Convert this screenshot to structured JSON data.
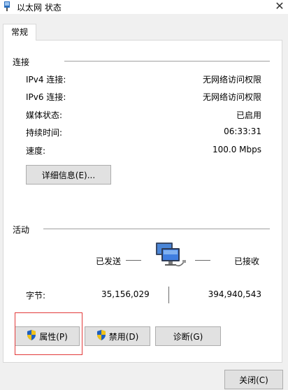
{
  "window": {
    "title": "以太网 状态",
    "close_glyph": "✕"
  },
  "tabs": [
    {
      "label": "常规"
    }
  ],
  "connection": {
    "heading": "连接",
    "rows": [
      {
        "label": "IPv4 连接:",
        "value": "无网络访问权限"
      },
      {
        "label": "IPv6 连接:",
        "value": "无网络访问权限"
      },
      {
        "label": "媒体状态:",
        "value": "已启用"
      },
      {
        "label": "持续时间:",
        "value": "06:33:31"
      },
      {
        "label": "速度:",
        "value": "100.0 Mbps"
      }
    ],
    "details_button": "详细信息(E)..."
  },
  "activity": {
    "heading": "活动",
    "sent_label": "已发送",
    "received_label": "已接收",
    "bytes_label": "字节:",
    "bytes_sent": "35,156,029",
    "bytes_received": "394,940,543",
    "network_icon": "network-computers-icon"
  },
  "buttons": {
    "properties": "属性(P)",
    "disable": "禁用(D)",
    "diagnose": "诊断(G)",
    "close": "关闭(C)"
  },
  "colors": {
    "highlight": "#e23b3b",
    "shield_blue": "#1f5fbf",
    "shield_yellow": "#f2c318"
  }
}
